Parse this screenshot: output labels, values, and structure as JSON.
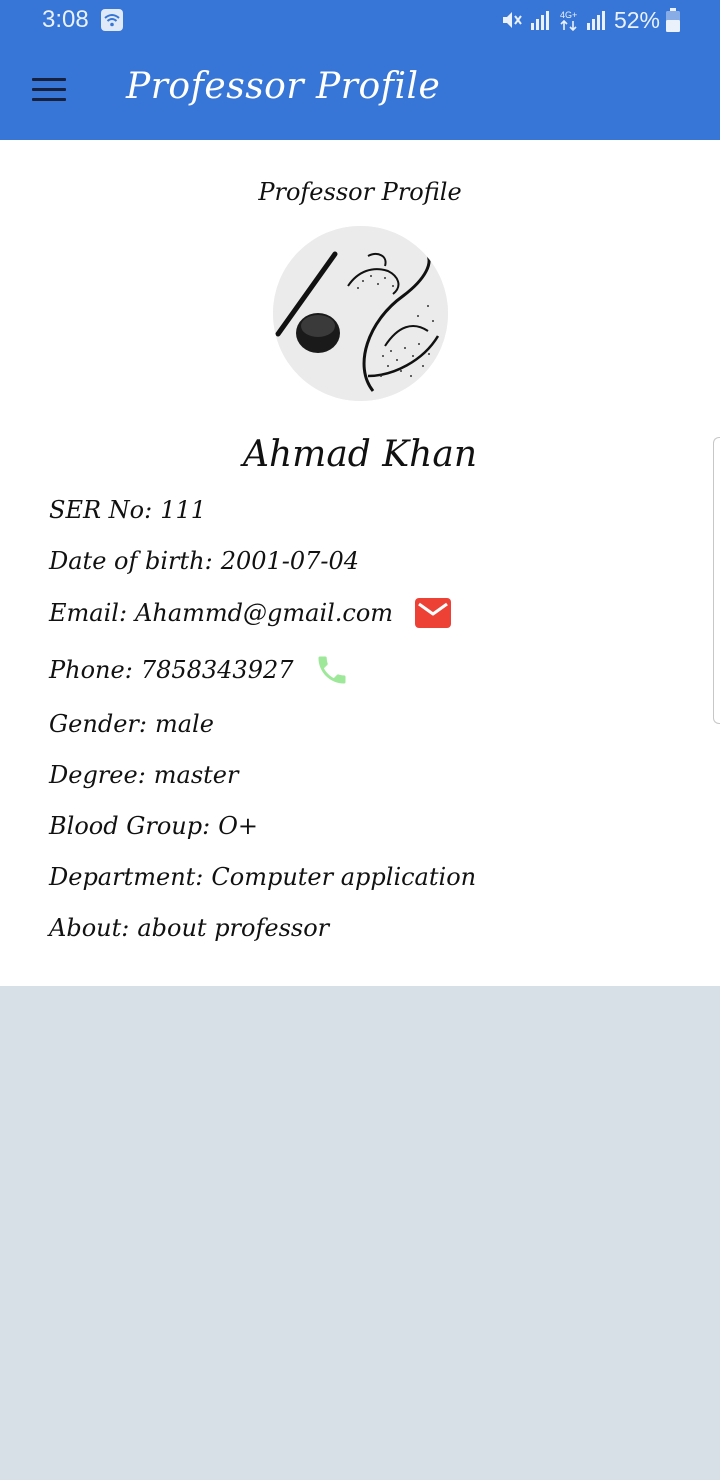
{
  "status_bar": {
    "time": "3:08",
    "battery": "52%",
    "icons": [
      "wifi-icon",
      "mute-icon",
      "signal-icon",
      "4g-icon",
      "signal-icon",
      "battery-icon"
    ]
  },
  "app_bar": {
    "title": "Professor Profile",
    "menu_icon": "hamburger-menu-icon",
    "color": "#3776d6"
  },
  "profile": {
    "heading": "Professor Profile",
    "name": "Ahmad Khan",
    "fields": {
      "ser_no": {
        "label": "SER No:",
        "value": "111"
      },
      "dob": {
        "label": "Date of birth:",
        "value": "2001-07-04"
      },
      "email": {
        "label": "Email:",
        "value": "Ahammd@gmail.com"
      },
      "phone": {
        "label": "Phone:",
        "value": "7858343927"
      },
      "gender": {
        "label": "Gender:",
        "value": "male"
      },
      "degree": {
        "label": "Degree:",
        "value": "master"
      },
      "blood_group": {
        "label": "Blood Group:",
        "value": "O+"
      },
      "department": {
        "label": "Department:",
        "value": "Computer application"
      },
      "about": {
        "label": "About:",
        "value": "about professor"
      }
    },
    "email_icon_color": "#ee4136",
    "phone_icon_color": "#9ee89a"
  }
}
